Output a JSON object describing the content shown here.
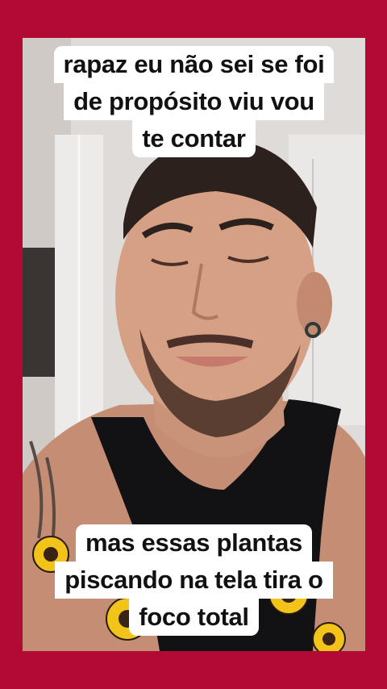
{
  "colors": {
    "border": "#b30a35",
    "caption_bg": "#ffffff",
    "caption_text": "#111111"
  },
  "captions": {
    "top": [
      "rapaz eu não sei se foi",
      "de propósito viu vou",
      "te contar"
    ],
    "bottom": [
      "mas essas plantas",
      "piscando na tela tira o",
      "foco total"
    ]
  }
}
